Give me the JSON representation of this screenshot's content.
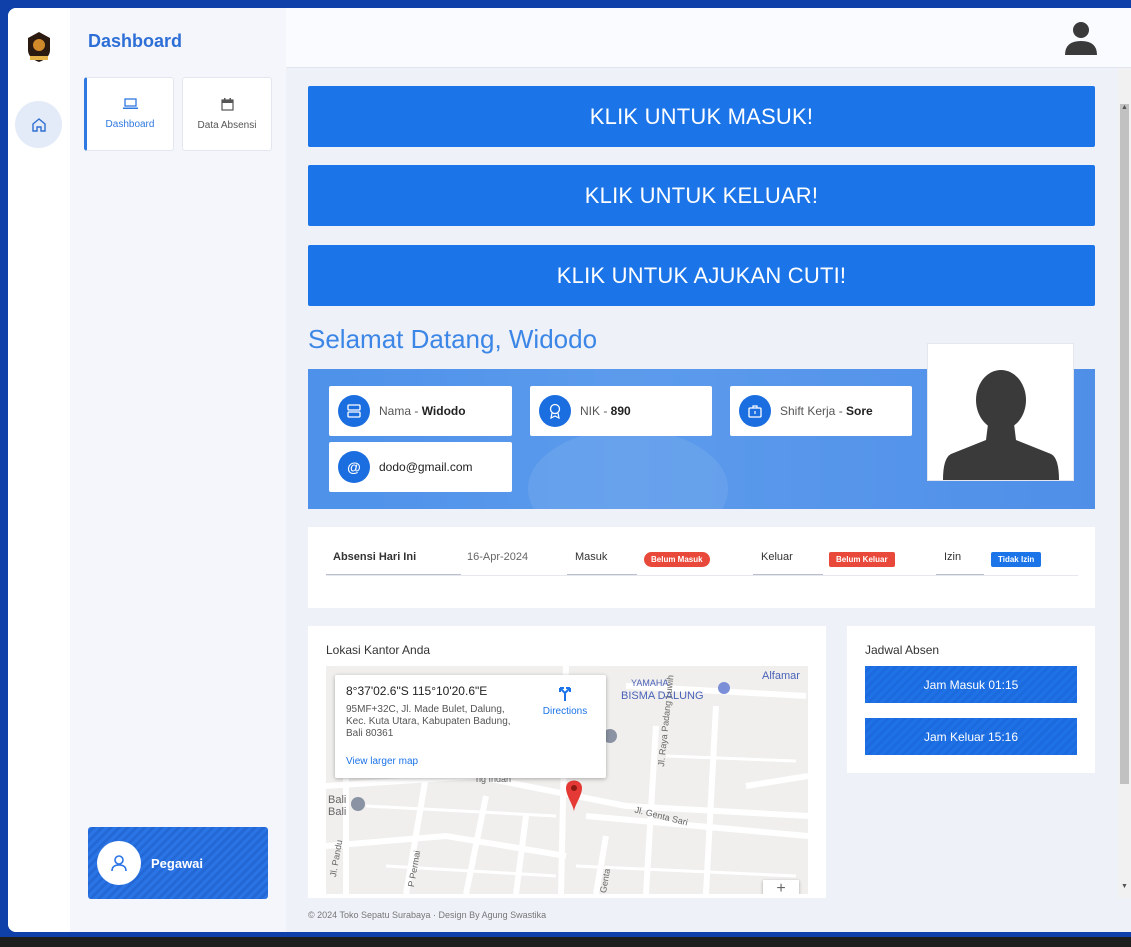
{
  "sidebar": {
    "title": "Dashboard",
    "tiles": [
      {
        "label": "Dashboard",
        "icon": "laptop-icon"
      },
      {
        "label": "Data Absensi",
        "icon": "calendar-icon"
      }
    ],
    "user_role": "Pegawai"
  },
  "actions": {
    "masuk": "KLIK UNTUK MASUK!",
    "keluar": "KLIK UNTUK KELUAR!",
    "cuti": "KLIK UNTUK AJUKAN CUTI!"
  },
  "welcome": "Selamat Datang, Widodo",
  "profile": {
    "nama_label": "Nama - ",
    "nama": "Widodo",
    "nik_label": "NIK - ",
    "nik": "890",
    "shift_label": "Shift Kerja - ",
    "shift": "Sore",
    "email": "dodo@gmail.com"
  },
  "absensi": {
    "title": "Absensi Hari Ini",
    "date": "16-Apr-2024",
    "masuk_label": "Masuk",
    "masuk_status": "Belum Masuk",
    "keluar_label": "Keluar",
    "keluar_status": "Belum Keluar",
    "izin_label": "Izin",
    "izin_status": "Tidak Izin"
  },
  "map": {
    "title": "Lokasi Kantor Anda",
    "coords": "8°37'02.6\"S 115°10'20.6\"E",
    "address": "95MF+32C, Jl. Made Bulet, Dalung, Kec. Kuta Utara, Kabupaten Badung, Bali 80361",
    "view_larger": "View larger map",
    "directions": "Directions",
    "labels": {
      "yamaha": "YAMAHA",
      "bisma": "BISMA DALUNG",
      "alfamart": "Alfamar",
      "genta": "Jl. Genta Sari",
      "padang": "Jl. Raya Padang Luwih",
      "bali1": "Bali",
      "bali2": "Bali",
      "pandu": "Jl. Pandu",
      "permai": "P Permai",
      "indah": "ng Indah",
      "genta2": "Genta",
      "zoom": "+"
    }
  },
  "jadwal": {
    "title": "Jadwal Absen",
    "masuk": "Jam Masuk 01:15",
    "keluar": "Jam Keluar 15:16"
  },
  "footer": "© 2024 Toko Sepatu Surabaya · Design By Agung Swastika",
  "colors": {
    "primary": "#1b74e8",
    "accent_text": "#3b86e6",
    "danger": "#e8493a"
  }
}
